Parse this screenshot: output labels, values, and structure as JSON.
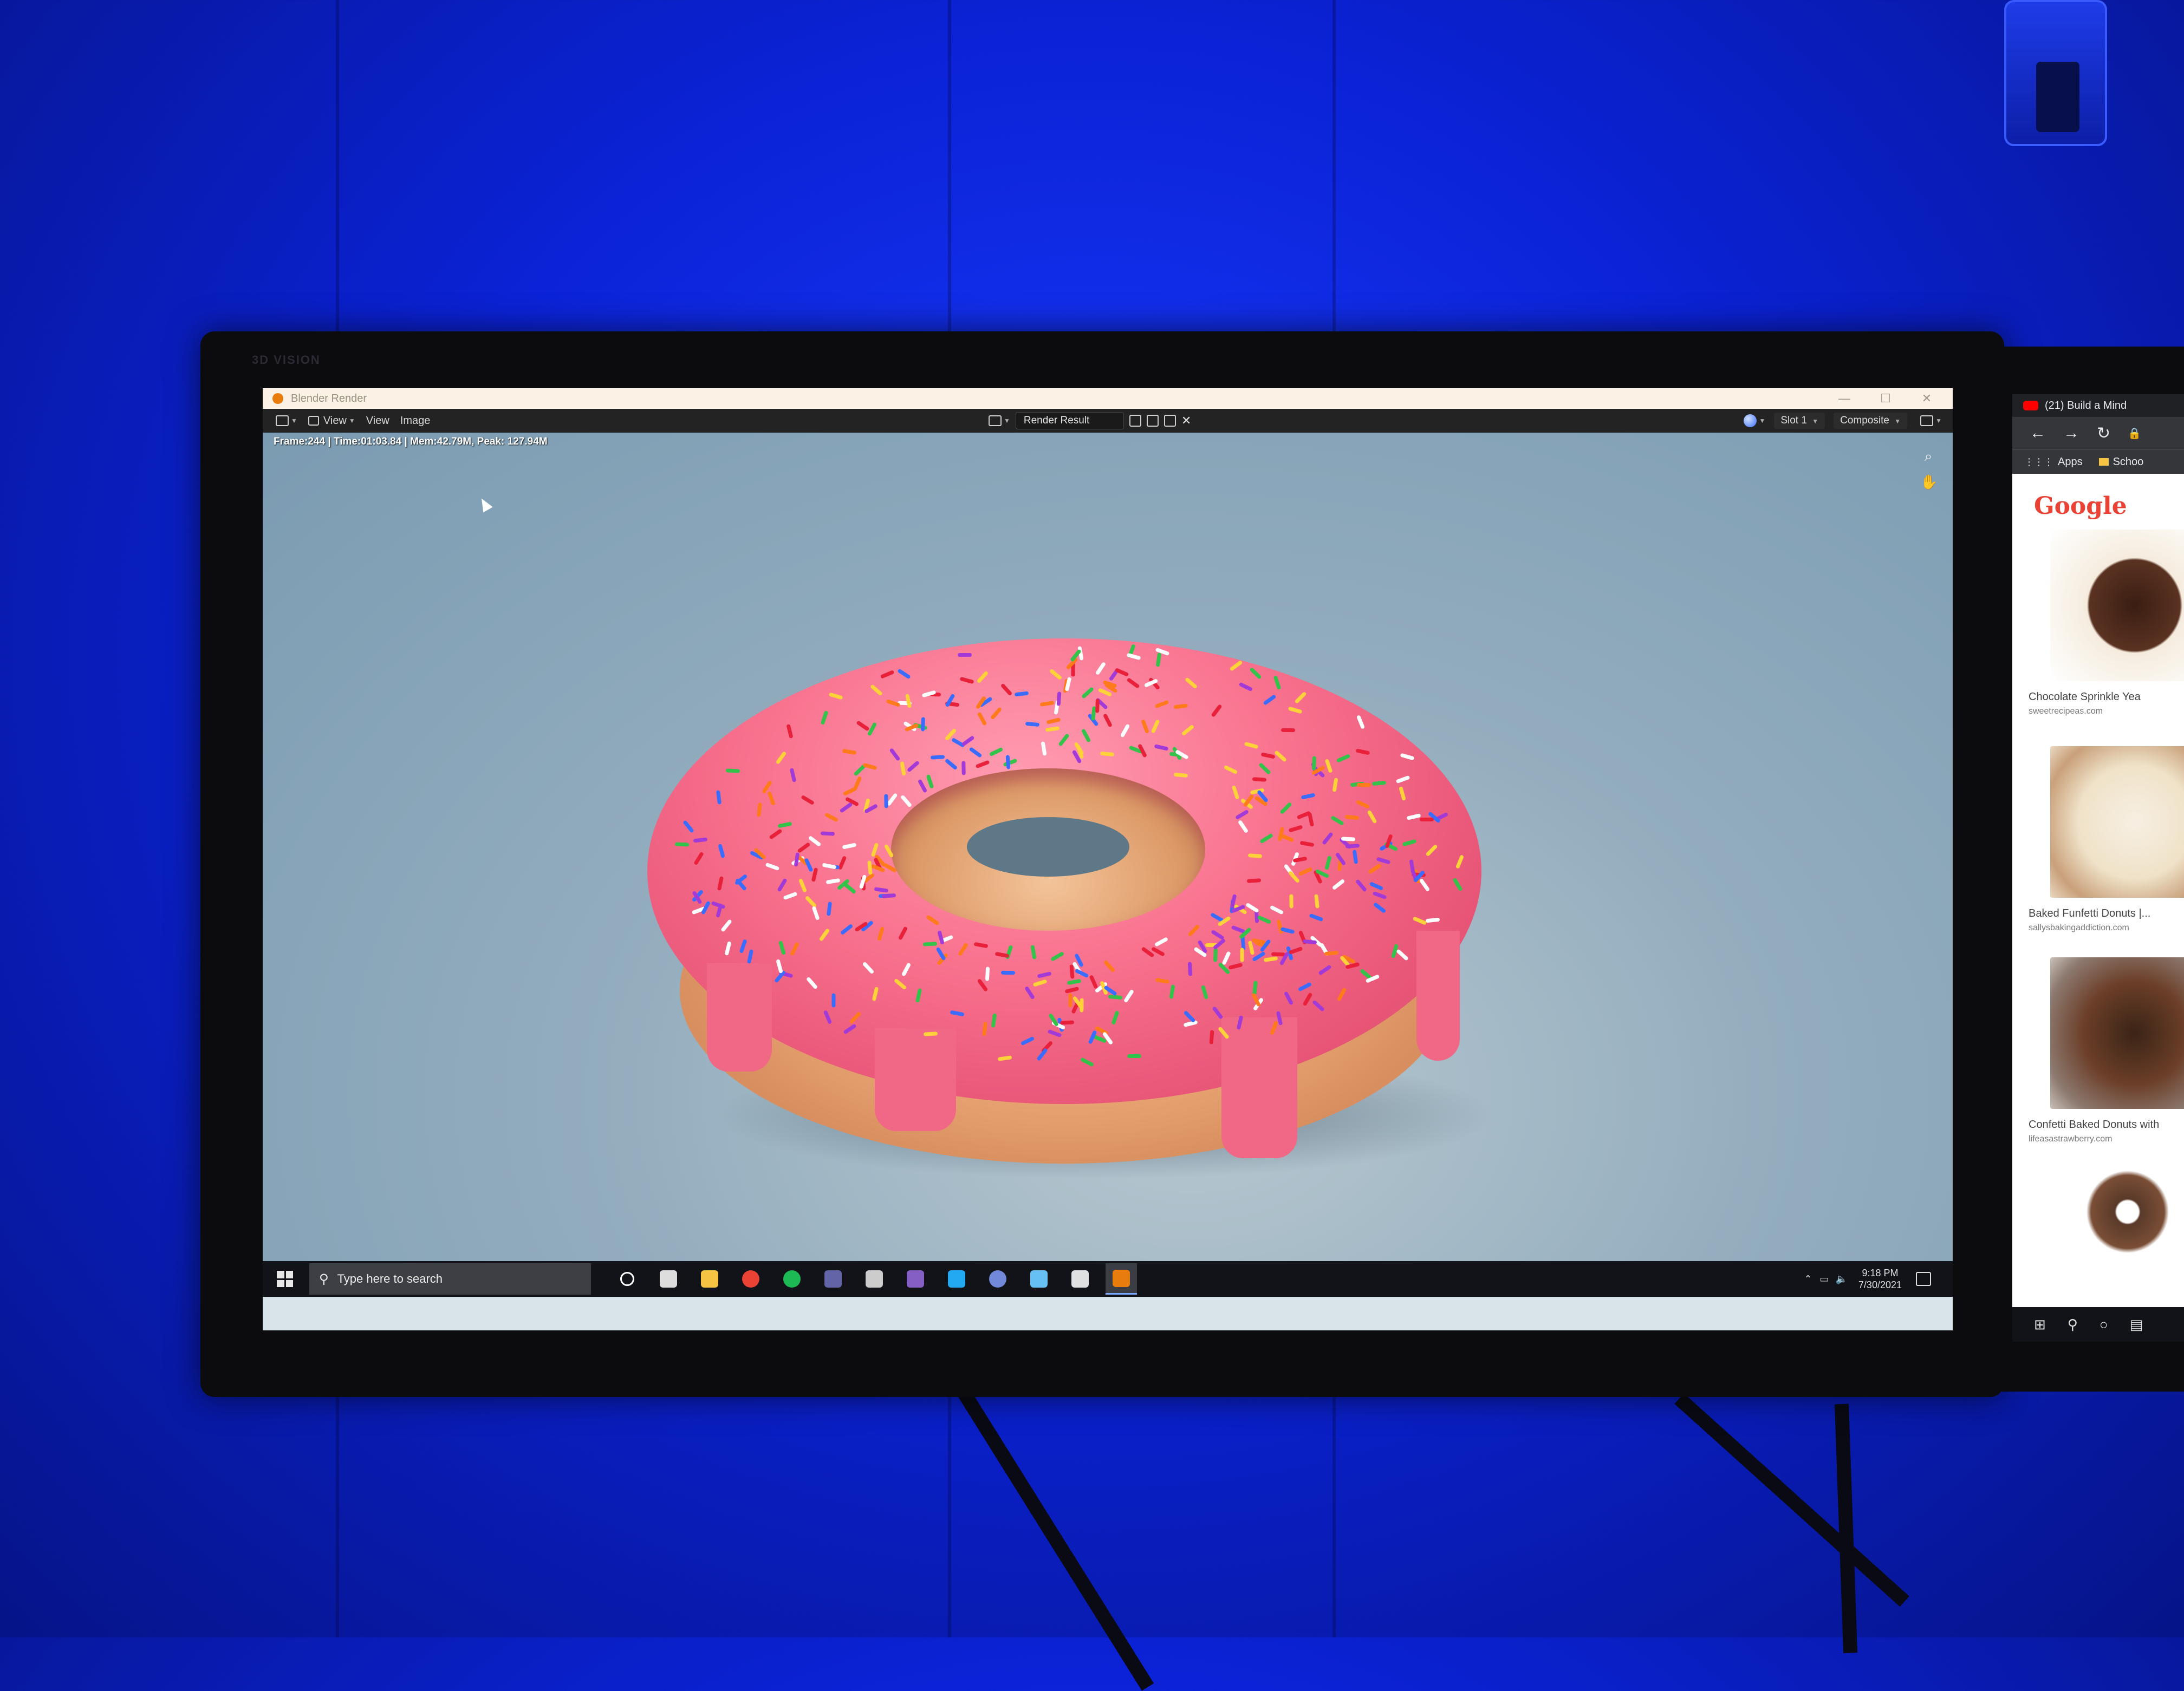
{
  "window": {
    "title": "Blender Render",
    "controls": [
      "—",
      "☐",
      "✕"
    ]
  },
  "monitor_brand": "3D VISION",
  "blender": {
    "menu": {
      "view_dropdown": "View",
      "view": "View",
      "image": "Image"
    },
    "image_name": "Render Result",
    "slot": "Slot 1",
    "pass": "Composite",
    "stats": "Frame:244 | Time:01:03.84 | Mem:42.79M, Peak: 127.94M"
  },
  "taskbar": {
    "search_placeholder": "Type here to search",
    "clock_time": "9:18 PM",
    "clock_date": "7/30/2021",
    "apps": [
      {
        "name": "cortana",
        "color": "#ffffff"
      },
      {
        "name": "task-view",
        "color": "#dddddd"
      },
      {
        "name": "file-explorer",
        "color": "#f6c343"
      },
      {
        "name": "chrome",
        "color": "#ea4335"
      },
      {
        "name": "spotify",
        "color": "#1db954"
      },
      {
        "name": "teams",
        "color": "#6264a7"
      },
      {
        "name": "terminal",
        "color": "#cccccc"
      },
      {
        "name": "visual-studio",
        "color": "#865fc5"
      },
      {
        "name": "vscode",
        "color": "#23a9f2"
      },
      {
        "name": "discord",
        "color": "#7289da"
      },
      {
        "name": "steam",
        "color": "#66c0f4"
      },
      {
        "name": "settings",
        "color": "#e0e0e0"
      },
      {
        "name": "blender",
        "color": "#e87d0d"
      }
    ]
  },
  "browser": {
    "tab_title": "(21) Build a Mind",
    "bookmark_apps": "Apps",
    "bookmark_folder": "Schoo",
    "doodle": "Google",
    "results": [
      {
        "title": "Chocolate Sprinkle Yea",
        "source": "sweetrecipeas.com"
      },
      {
        "title": "Baked Funfetti Donuts |...",
        "source": "sallysbakingaddiction.com"
      },
      {
        "title": "Confetti Baked Donuts with",
        "source": "lifeasastrawberry.com"
      }
    ]
  },
  "colors": {
    "icing": "#f9738f",
    "blender_header": "#232323",
    "taskbar": "#111318",
    "wall": "#1a3cff"
  }
}
